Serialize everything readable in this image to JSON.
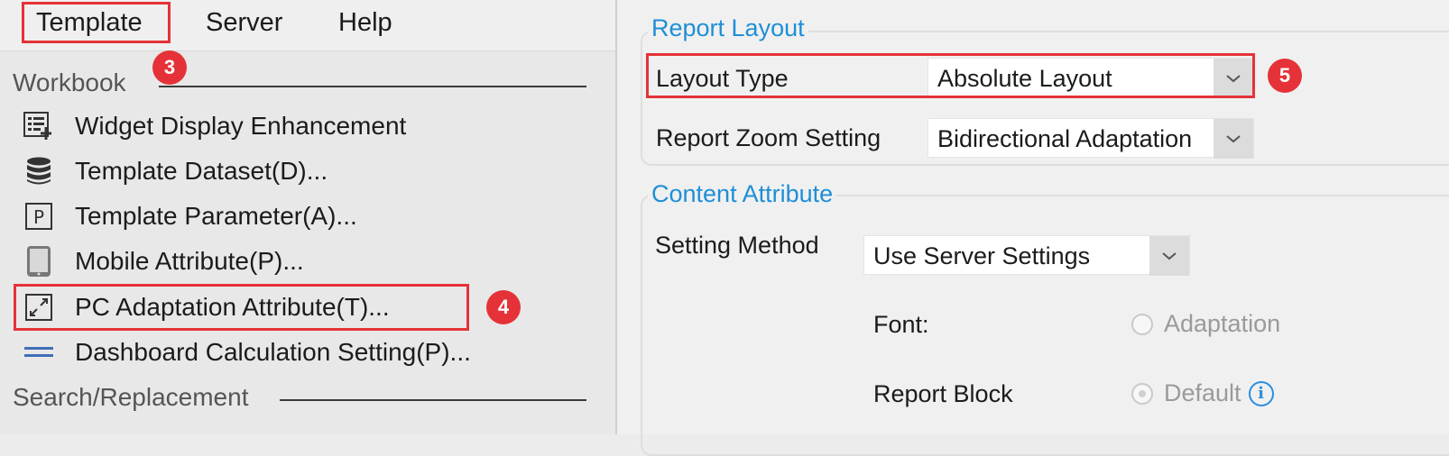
{
  "menubar": {
    "items": [
      {
        "label": "Template"
      },
      {
        "label": "Server"
      },
      {
        "label": "Help"
      }
    ]
  },
  "annotations": {
    "step3": "3",
    "step4": "4",
    "step5": "5"
  },
  "menu": {
    "section_workbook": "Workbook",
    "items": [
      {
        "label": "Widget Display Enhancement",
        "icon": "widget-display-icon"
      },
      {
        "label": "Template Dataset(D)...",
        "icon": "database-icon"
      },
      {
        "label": "Template Parameter(A)...",
        "icon": "parameter-icon"
      },
      {
        "label": "Mobile Attribute(P)...",
        "icon": "mobile-icon"
      },
      {
        "label": "PC Adaptation Attribute(T)...",
        "icon": "expand-arrows-icon"
      },
      {
        "label": "Dashboard Calculation Setting(P)...",
        "icon": "equals-lines-icon"
      }
    ],
    "section_search": "Search/Replacement"
  },
  "report_layout": {
    "title": "Report Layout",
    "layout_type_label": "Layout Type",
    "layout_type_value": "Absolute Layout",
    "zoom_label": "Report Zoom Setting",
    "zoom_value": "Bidirectional Adaptation"
  },
  "content_attribute": {
    "title": "Content Attribute",
    "setting_method_label": "Setting Method",
    "setting_method_value": "Use Server Settings",
    "font_label": "Font:",
    "font_option": "Adaptation",
    "report_block_label": "Report Block",
    "report_block_option": "Default"
  },
  "colors": {
    "accent": "#1e8fd6",
    "annotation_red": "#e53238"
  }
}
